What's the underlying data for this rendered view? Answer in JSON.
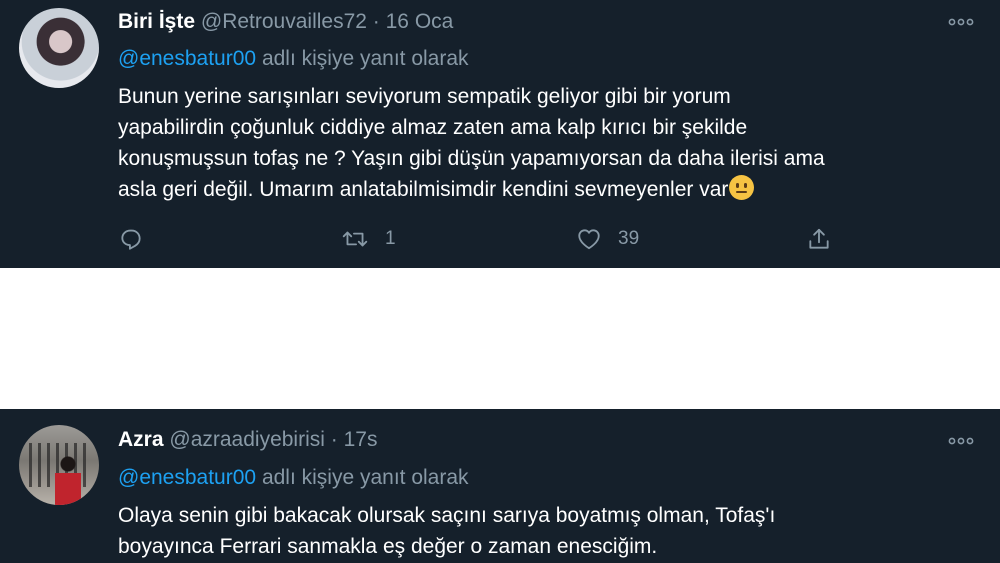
{
  "tweets": [
    {
      "name": "Biri İşte",
      "handle": "@Retrouvailles72",
      "separator": "·",
      "time": "16 Oca",
      "reply_mention": "@enesbatur00",
      "reply_suffix": "adlı kişiye yanıt olarak",
      "lines": [
        "Bunun yerine sarışınları seviyorum sempatik geliyor gibi bir yorum",
        "yapabilirdin çoğunluk ciddiye almaz zaten ama kalp kırıcı bir şekilde",
        "konuşmuşsun tofaş ne ? Yaşın gibi  düşün yapamıyorsan  da daha ilerisi ama",
        "asla geri değil.  Umarım anlatabilmisimdir kendini sevmeyenler var"
      ],
      "emoji": "neutral-face",
      "actions": {
        "retweets": "1",
        "likes": "39"
      }
    },
    {
      "name": "Azra",
      "handle": "@azraadiyebirisi",
      "separator": "·",
      "time": "17s",
      "reply_mention": "@enesbatur00",
      "reply_suffix": "adlı kişiye yanıt olarak",
      "lines": [
        "Olaya senin gibi bakacak olursak saçını sarıya boyatmış olman, Tofaş'ı",
        "boyayınca Ferrari sanmakla eş değer o zaman enesciğim."
      ]
    }
  ],
  "colors": {
    "background": "#15202b",
    "text": "#ffffff",
    "secondary": "#8899a6",
    "link": "#1da1f2"
  },
  "icons": [
    "more-icon",
    "reply-icon",
    "retweet-icon",
    "like-icon",
    "share-icon"
  ]
}
